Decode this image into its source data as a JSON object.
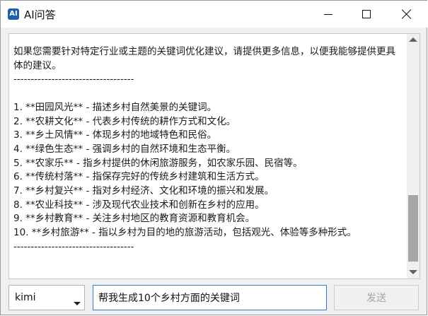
{
  "window": {
    "title": "AI问答",
    "icon": "app-logo-icon",
    "icon_glyph": "AI",
    "controls": {
      "minimize": "minimize-icon",
      "maximize": "maximize-icon",
      "close": "close-icon"
    }
  },
  "chat": {
    "response_text": "如果您需要针对特定行业或主题的关键词优化建议，请提供更多信息，以便我能够提供更具体的建议。\n-----------------------------------\n\n1. **田园风光** - 描述乡村自然美景的关键词。\n2. **农耕文化** - 代表乡村传统的耕作方式和文化。\n3. **乡土风情** - 体现乡村的地域特色和民俗。\n4. **绿色生态** - 强调乡村的自然环境和生态平衡。\n5. **农家乐** - 指乡村提供的休闲旅游服务，如农家乐园、民宿等。\n6. **传统村落** - 指保存完好的传统乡村建筑和生活方式。\n7. **乡村复兴** - 指对乡村经济、文化和环境的振兴和发展。\n8. **农业科技** - 涉及现代农业技术和创新在乡村的应用。\n9. **乡村教育** - 关注乡村地区的教育资源和教育机会。\n10. **乡村旅游** - 指以乡村为目的地的旅游活动，包括观光、体验等多种形式。\n-----------------------------------"
  },
  "scrollbar": {
    "position_fraction": 0.85
  },
  "footer": {
    "model_value": "kimi",
    "input_value": "帮我生成10个乡村方面的关键词",
    "send_label": "发送"
  },
  "colors": {
    "titlebar": "#ffffff",
    "frame": "#f0f0f0",
    "input_focus_border": "#2a7dd1",
    "disabled_text": "#a5a5a5",
    "scroll_thumb": "#a6a6a6"
  }
}
